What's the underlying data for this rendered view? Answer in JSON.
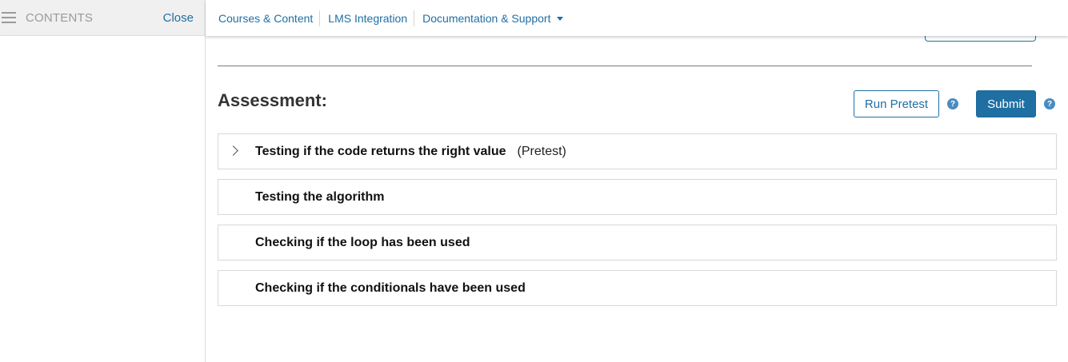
{
  "sidebar": {
    "contents_label": "CONTENTS",
    "close_label": "Close"
  },
  "nav": {
    "items": [
      "Courses & Content",
      "LMS Integration",
      "Documentation & Support"
    ]
  },
  "assessment": {
    "title": "Assessment:",
    "run_pretest_label": "Run Pretest",
    "submit_label": "Submit",
    "help_glyph": "?",
    "tests": [
      {
        "name": "Testing if the code returns the right value",
        "tag": "(Pretest)",
        "expandable": true
      },
      {
        "name": "Testing the algorithm"
      },
      {
        "name": "Checking if the loop has been used"
      },
      {
        "name": "Checking if the conditionals have been used"
      }
    ]
  },
  "colors": {
    "accent": "#1f6fa3",
    "help": "#4a8cc0",
    "divider": "#7a7a7a"
  }
}
